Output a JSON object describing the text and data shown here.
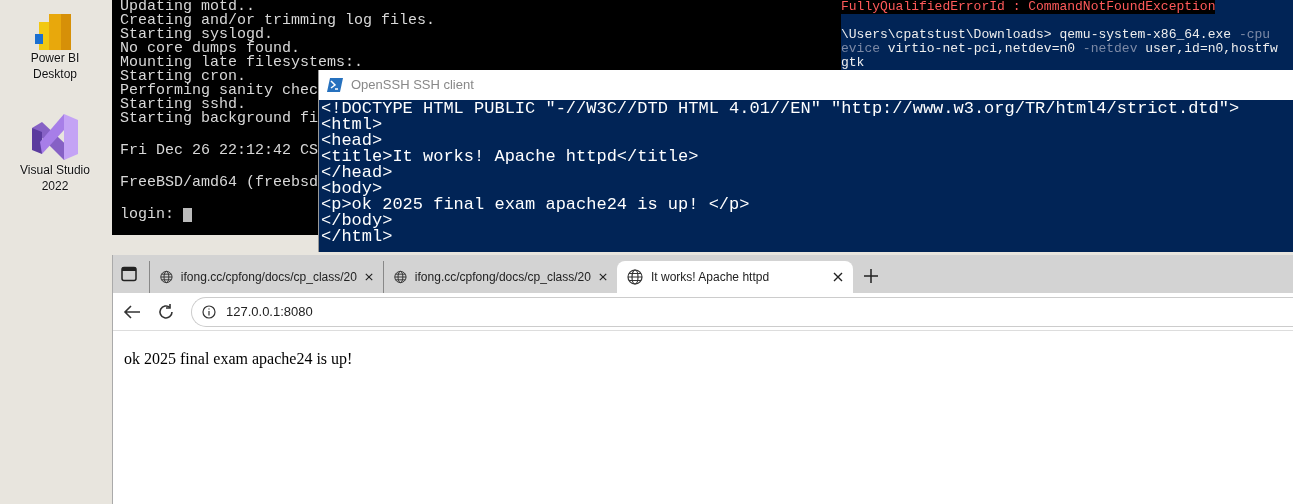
{
  "desktop_icons": [
    {
      "kind": "bars",
      "label": "Power BI Desktop"
    },
    {
      "kind": "loop",
      "label": "Visual Studio 2022"
    }
  ],
  "console": {
    "lines": [
      {
        "text": "Updating motd..",
        "gap_before": false
      },
      {
        "text": "Creating and/or trimming log files.",
        "gap_before": false
      },
      {
        "text": "Starting syslogd.",
        "gap_before": false
      },
      {
        "text": "No core dumps found.",
        "gap_before": false
      },
      {
        "text": "Mounting late filesystems:.",
        "gap_before": false
      },
      {
        "text": "Starting cron.",
        "gap_before": false
      },
      {
        "text": "Performing sanity chec",
        "gap_before": false
      },
      {
        "text": "Starting sshd.",
        "gap_before": false
      },
      {
        "text": "Starting background fi",
        "gap_before": false
      },
      {
        "text": "Fri Dec 26 22:12:42 CS",
        "gap_before": true
      },
      {
        "text": "FreeBSD/amd64 (freebsd",
        "gap_before": true
      },
      {
        "text": "login:",
        "gap_before": true
      }
    ]
  },
  "powershell": {
    "lines": [
      {
        "gap_before": false,
        "segments": [
          {
            "text": "FullyQualifiedErrorId : CommandNotFoundException",
            "kind": "error"
          }
        ]
      },
      {
        "gap_before": true,
        "segments": [
          {
            "text": "\\Users\\cpatstust\\Downloads> qemu-system-x86_64.exe ",
            "kind": "normal"
          },
          {
            "text": "-cpu",
            "kind": "dim"
          }
        ]
      },
      {
        "gap_before": false,
        "segments": [
          {
            "text": "evice ",
            "kind": "dim"
          },
          {
            "text": "virtio-net-pci,netdev=n0 ",
            "kind": "normal"
          },
          {
            "text": "-netdev ",
            "kind": "dim"
          },
          {
            "text": "user,id=n0,hostfw",
            "kind": "normal"
          }
        ]
      },
      {
        "gap_before": false,
        "segments": [
          {
            "text": "gtk",
            "kind": "normal"
          }
        ]
      }
    ]
  },
  "ssh": {
    "title": "OpenSSH SSH client",
    "lines": [
      "<!DOCTYPE HTML PUBLIC \"-//W3C//DTD HTML 4.01//EN\" \"http://www.w3.org/TR/html4/strict.dtd\">",
      "<html>",
      "<head>",
      "<title>It works! Apache httpd</title>",
      "</head>",
      "<body>",
      "<p>ok 2025 final exam apache24 is up! </p>",
      "</body>",
      "</html>"
    ]
  },
  "browser": {
    "tabs": [
      {
        "label": "ifong.cc/cpfong/docs/cp_class/20",
        "selected": false
      },
      {
        "label": "ifong.cc/cpfong/docs/cp_class/20",
        "selected": false
      },
      {
        "label": "It works! Apache httpd",
        "selected": true
      }
    ],
    "address": "127.0.0.1:8080",
    "page_text": "ok 2025 final exam apache24 is up!"
  }
}
